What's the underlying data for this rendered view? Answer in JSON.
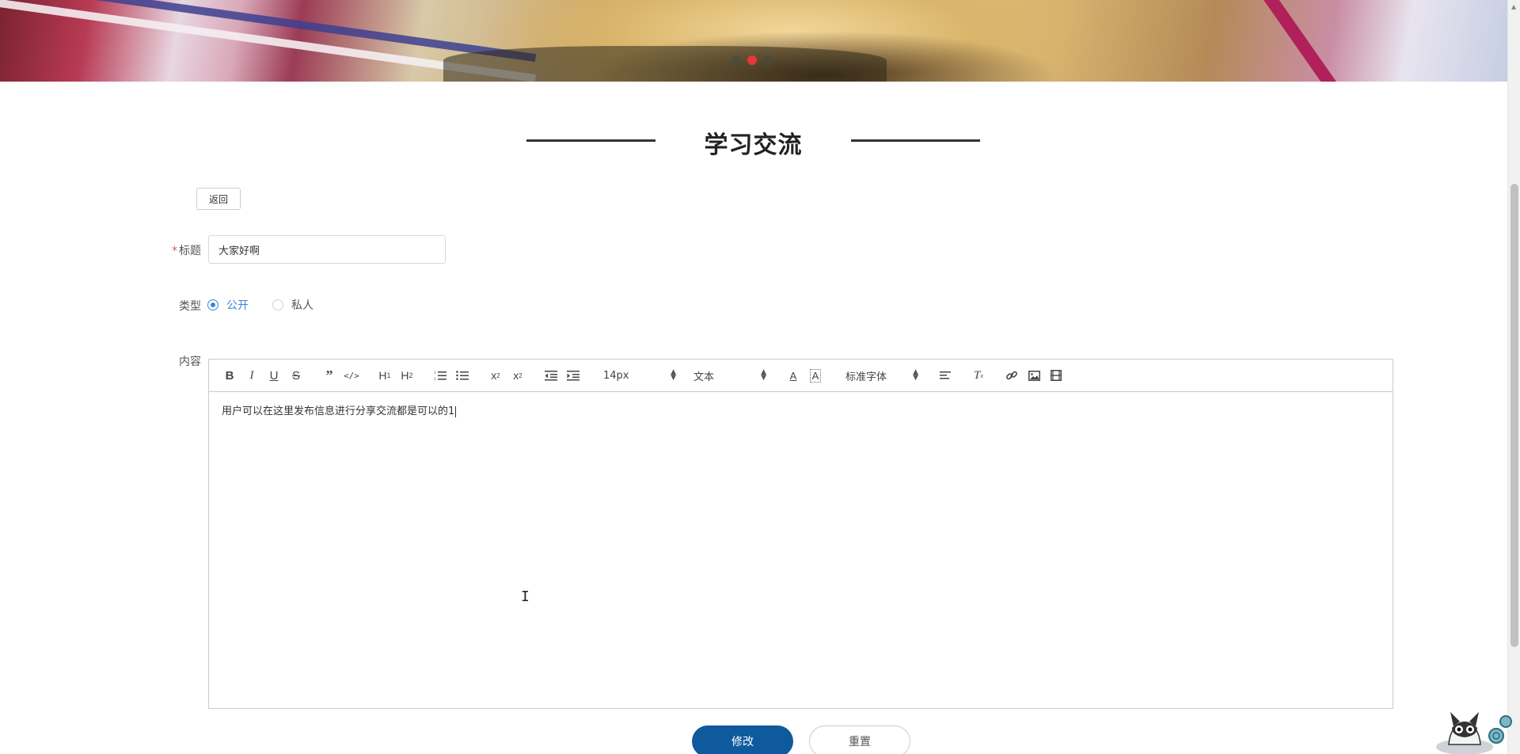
{
  "carousel": {
    "slide_count": 3,
    "active_index": 1
  },
  "section": {
    "title": "学习交流"
  },
  "back_button": {
    "label": "返回"
  },
  "form": {
    "title_label": "标题",
    "title_required_mark": "*",
    "title_value": "大家好啊",
    "type_label": "类型",
    "type_options": [
      {
        "label": "公开",
        "checked": true
      },
      {
        "label": "私人",
        "checked": false
      }
    ],
    "content_label": "内容",
    "content_text": "用户可以在这里发布信息进行分享交流都是可以的1"
  },
  "editor_toolbar": {
    "font_size": "14px",
    "header_select": "文本",
    "font_family": "标准字体",
    "icons": [
      "bold-icon",
      "italic-icon",
      "underline-icon",
      "strike-icon",
      "blockquote-icon",
      "code-block-icon",
      "h1-icon",
      "h2-icon",
      "ordered-list-icon",
      "bullet-list-icon",
      "subscript-icon",
      "superscript-icon",
      "outdent-icon",
      "indent-icon",
      "font-color-icon",
      "background-color-icon",
      "align-icon",
      "clear-format-icon",
      "link-icon",
      "image-icon",
      "video-icon"
    ]
  },
  "buttons": {
    "submit_label": "修改",
    "reset_label": "重置"
  },
  "colors": {
    "primary": "#0e5a9c",
    "radio_active": "#3b86d6",
    "required": "#e05a5a",
    "carousel_active": "#e23a3a"
  }
}
